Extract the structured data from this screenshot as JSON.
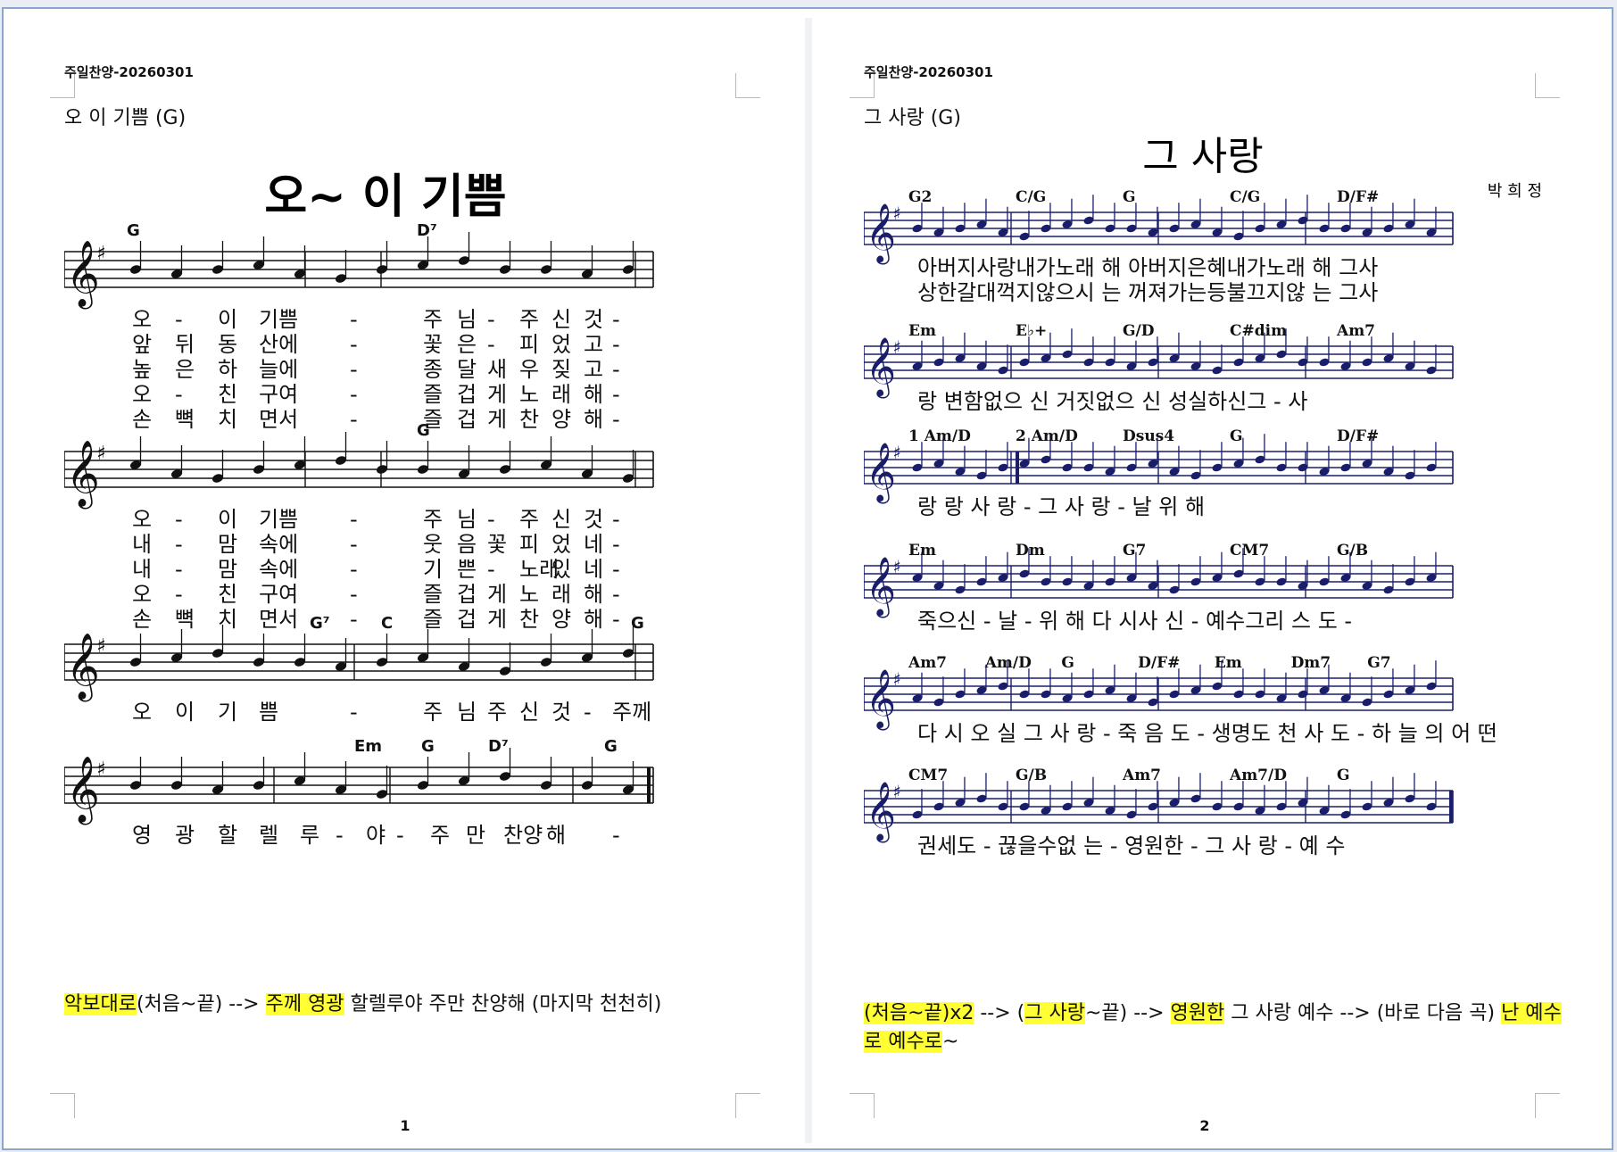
{
  "pages": [
    {
      "header": "주일찬양-20260301",
      "subtitle": "오 이 기쁨 (G)",
      "song_title": "오~ 이 기쁨",
      "page_number": "1",
      "note": [
        {
          "text": "악보대로",
          "hl": true
        },
        {
          "text": "(처음~끝) --> ",
          "hl": false
        },
        {
          "text": "주께 영광",
          "hl": true
        },
        {
          "text": " 할렐루야 주만 찬양해 (마지막 천천히)",
          "hl": false
        }
      ],
      "systems": [
        {
          "chords": [
            "G",
            "D⁷"
          ],
          "verses": [
            [
              "오",
              "-",
              "이",
              "기쁨",
              "-",
              "주",
              "님",
              "-",
              "주",
              "신",
              "것",
              "-"
            ],
            [
              "앞",
              "뒤",
              "동",
              "산에",
              "-",
              "꽃",
              "은",
              "-",
              "피",
              "었",
              "고",
              "-"
            ],
            [
              "높",
              "은",
              "하",
              "늘에",
              "-",
              "종",
              "달",
              "새",
              "우",
              "짖",
              "고",
              "-"
            ],
            [
              "오",
              "-",
              "친",
              "구여",
              "-",
              "즐",
              "겁",
              "게",
              "노",
              "래",
              "해",
              "-"
            ],
            [
              "손",
              "뼉",
              "치",
              "면서",
              "-",
              "즐",
              "겁",
              "게",
              "찬",
              "양",
              "해",
              "-"
            ]
          ]
        },
        {
          "chords": [
            "G"
          ],
          "verses": [
            [
              "오",
              "-",
              "이",
              "기쁨",
              "-",
              "주",
              "님",
              "-",
              "주",
              "신",
              "것",
              "-"
            ],
            [
              "내",
              "-",
              "맘",
              "속에",
              "-",
              "웃",
              "음",
              "꽃",
              "피",
              "었",
              "네",
              "-"
            ],
            [
              "내",
              "-",
              "맘",
              "속에",
              "-",
              "기",
              "쁜",
              "-",
              "노래",
              "있",
              "네",
              "-"
            ],
            [
              "오",
              "-",
              "친",
              "구여",
              "-",
              "즐",
              "겁",
              "게",
              "노",
              "래",
              "해",
              "-"
            ],
            [
              "손",
              "뼉",
              "치",
              "면서",
              "-",
              "즐",
              "겁",
              "게",
              "찬",
              "양",
              "해",
              "-"
            ]
          ]
        },
        {
          "chords": [
            "G⁷",
            "C",
            "G"
          ],
          "verses": [
            [
              "오",
              "이",
              "기",
              "쁨",
              "-",
              "주",
              "님",
              "주",
              "신",
              "것",
              "-",
              "주께"
            ]
          ]
        },
        {
          "chords": [
            "Em",
            "G",
            "D⁷",
            "G"
          ],
          "verses": [
            [
              "영",
              "광",
              "할",
              "렐",
              "루",
              "-",
              "야",
              "-",
              "주",
              "만",
              "찬양",
              "해",
              "-"
            ]
          ]
        }
      ]
    },
    {
      "header": "주일찬양-20260301",
      "subtitle": "그 사랑 (G)",
      "song_title": "그 사랑",
      "composer": "박 희 정",
      "page_number": "2",
      "note": [
        {
          "text": "(처음~끝)x2",
          "hl": true
        },
        {
          "text": " --> (",
          "hl": false
        },
        {
          "text": "그 사랑",
          "hl": true
        },
        {
          "text": "~끝)  --> ",
          "hl": false
        },
        {
          "text": "영원한",
          "hl": true
        },
        {
          "text": " 그 사랑 예수 --> (바로 다음 곡) ",
          "hl": false
        },
        {
          "text": "난 예수로 예수로",
          "hl": true
        },
        {
          "text": "~",
          "hl": false
        }
      ],
      "systems": [
        {
          "chords": [
            "G2",
            "C/G",
            "G",
            "C/G",
            "D/F#"
          ],
          "lyrics": [
            "아버지사랑내가노래 해  아버지은혜내가노래 해  그사",
            "상한갈대꺽지않으시 는  꺼져가는등불끄지않 는  그사"
          ]
        },
        {
          "chords": [
            "Em",
            "E♭+",
            "G/D",
            "C#dim",
            "Am7"
          ],
          "lyrics": [
            "랑    변함없으 신    거짓없으 신 성실하신그 - 사"
          ]
        },
        {
          "chords": [
            "1 Am/D",
            "2 Am/D",
            "Dsus4",
            "G",
            "D/F#"
          ],
          "lyrics": [
            "랑          랑        사  랑     - 그 사 랑   - 날 위 해"
          ]
        },
        {
          "chords": [
            "Em",
            "Dm",
            "G7",
            "CM7",
            "G/B"
          ],
          "lyrics": [
            "죽으신  - 날  - 위 해  다  시사  신 -  예수그리 스 도 -"
          ]
        },
        {
          "chords": [
            "Am7",
            "Am/D",
            "G",
            "D/F#",
            "Em",
            "Dm7",
            "G7"
          ],
          "lyrics": [
            "다 시 오 실 그 사 랑 - 죽 음 도     - 생명도 천 사 도 -  하  늘 의 어 떤"
          ]
        },
        {
          "chords": [
            "CM7",
            "G/B",
            "Am7",
            "Am7/D",
            "G"
          ],
          "lyrics": [
            "권세도 -  끊을수없 는 -    영원한  -    그 사 랑 - 예    수"
          ]
        }
      ]
    }
  ]
}
